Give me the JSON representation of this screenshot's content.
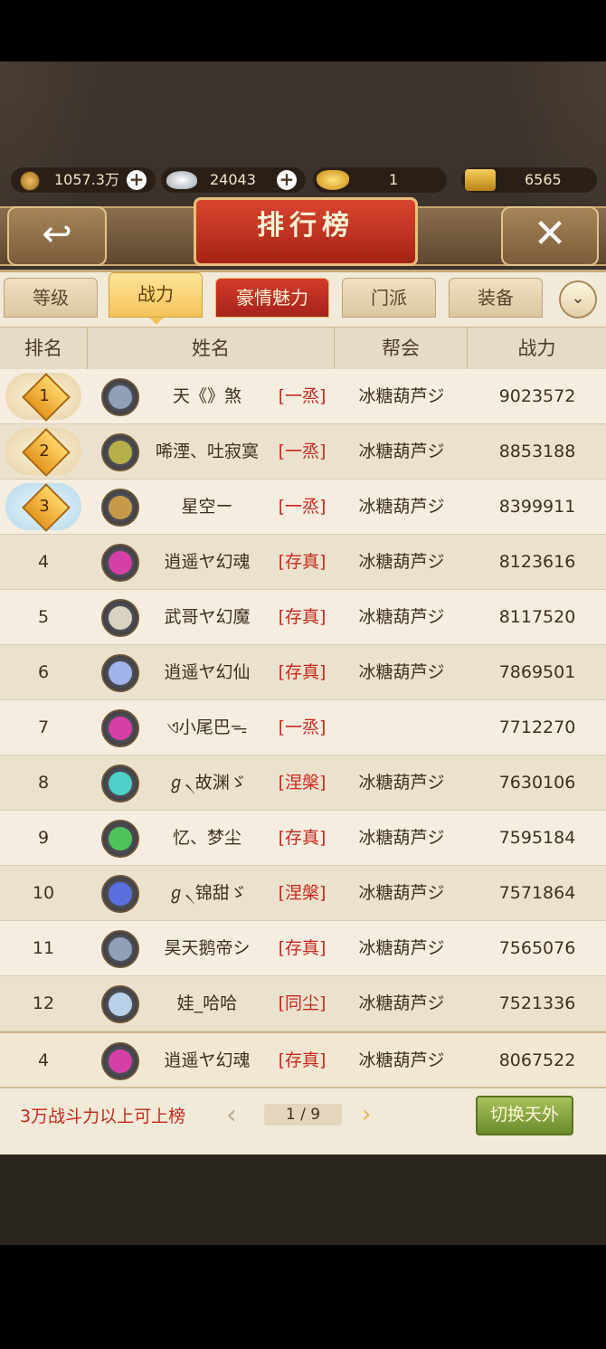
{
  "currency": {
    "copper": "1057.3万",
    "silver": "24043",
    "gold": "1",
    "locked_gold": "6565"
  },
  "title": "排行榜",
  "tabs": [
    "等级",
    "战力",
    "豪情魅力",
    "门派",
    "装备"
  ],
  "active_tab": "战力",
  "headers": {
    "rank": "排名",
    "name": "姓名",
    "guild": "帮会",
    "power": "战力"
  },
  "rows": [
    {
      "rank": "1",
      "name": "天《》煞",
      "sect": "[一烝]",
      "guild": "冰糖葫芦ジ",
      "power": "9023572"
    },
    {
      "rank": "2",
      "name": "唏湮、吐寂寞",
      "sect": "[一烝]",
      "guild": "冰糖葫芦ジ",
      "power": "8853188"
    },
    {
      "rank": "3",
      "name": "星空ー",
      "sect": "[一烝]",
      "guild": "冰糖葫芦ジ",
      "power": "8399911"
    },
    {
      "rank": "4",
      "name": "逍遥ヤ幻魂",
      "sect": "[存真]",
      "guild": "冰糖葫芦ジ",
      "power": "8123616"
    },
    {
      "rank": "5",
      "name": "武哥ヤ幻魔",
      "sect": "[存真]",
      "guild": "冰糖葫芦ジ",
      "power": "8117520"
    },
    {
      "rank": "6",
      "name": "逍遥ヤ幻仙",
      "sect": "[存真]",
      "guild": "冰糖葫芦ジ",
      "power": "7869501"
    },
    {
      "rank": "7",
      "name": "ଏ小尾巴ᯓ",
      "sect": "[一烝]",
      "guild": "",
      "power": "7712270"
    },
    {
      "rank": "8",
      "name": "ℊ৲故渊ゞ",
      "sect": "[涅槃]",
      "guild": "冰糖葫芦ジ",
      "power": "7630106"
    },
    {
      "rank": "9",
      "name": "忆、梦尘",
      "sect": "[存真]",
      "guild": "冰糖葫芦ジ",
      "power": "7595184"
    },
    {
      "rank": "10",
      "name": "ℊ৲锦甜ゞ",
      "sect": "[涅槃]",
      "guild": "冰糖葫芦ジ",
      "power": "7571864"
    },
    {
      "rank": "11",
      "name": "昊天鹅帝シ",
      "sect": "[存真]",
      "guild": "冰糖葫芦ジ",
      "power": "7565076"
    },
    {
      "rank": "12",
      "name": "娃_哈哈",
      "sect": "[同尘]",
      "guild": "冰糖葫芦ジ",
      "power": "7521336"
    }
  ],
  "my_row": {
    "rank": "4",
    "name": "逍遥ヤ幻魂",
    "sect": "[存真]",
    "guild": "冰糖葫芦ジ",
    "power": "8067522"
  },
  "footer": {
    "hint": "3万战斗力以上可上榜",
    "page": "1 / 9",
    "switch_label": "切换天外"
  },
  "icons": {
    "back": "back-arrow-icon",
    "close": "close-icon",
    "dropdown": "chevron-down-icon"
  },
  "colors": {
    "sect_red": "#c8281c",
    "tab_active": "#f3c35a",
    "special_tab": "#c8301f"
  }
}
